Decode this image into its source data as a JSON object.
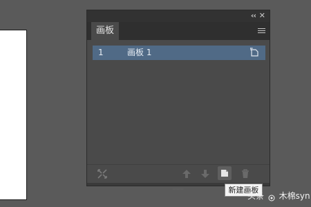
{
  "panel": {
    "tab_label": "画板",
    "collapse_glyph": "‹‹",
    "close_glyph": "✕",
    "menu_icon": "hamburger-menu-icon"
  },
  "artboards": [
    {
      "index": "1",
      "name": "画板  1",
      "options_icon": "artboard-options-icon"
    }
  ],
  "footer": {
    "buttons": [
      "rearrange-icon",
      "move-up-icon",
      "move-down-icon",
      "new-artboard-icon",
      "delete-icon"
    ]
  },
  "tooltip": {
    "text": "新建画板"
  },
  "watermark": {
    "prefix": "头条",
    "author": "木棉syn"
  },
  "colors": {
    "background": "#5a5a5a",
    "panel": "#4a4a4a",
    "selected_row": "#506a86"
  }
}
